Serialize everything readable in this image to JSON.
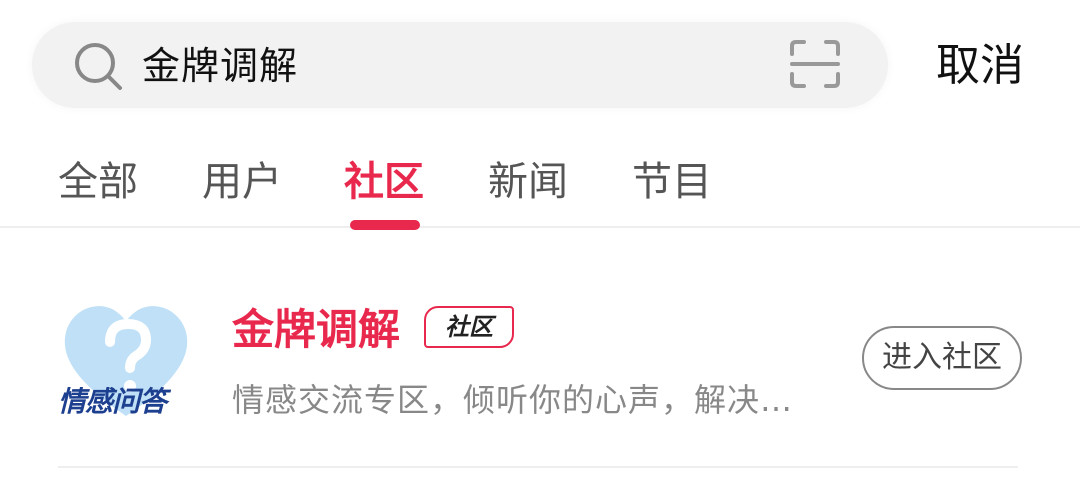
{
  "search": {
    "query": "金牌调解",
    "cancel_label": "取消"
  },
  "tabs": [
    {
      "label": "全部",
      "active": false
    },
    {
      "label": "用户",
      "active": false
    },
    {
      "label": "社区",
      "active": true
    },
    {
      "label": "新闻",
      "active": false
    },
    {
      "label": "节目",
      "active": false
    }
  ],
  "result": {
    "title": "金牌调解",
    "tag": "社区",
    "thumbnail_caption": "情感问答",
    "description": "情感交流专区，倾听你的心声，解决…",
    "enter_label": "进入社区"
  },
  "colors": {
    "accent": "#e8284c",
    "thumbnail_caption": "#1d3f8f",
    "heart_fill": "#bfe0f6"
  },
  "icons": {
    "search": "search-icon",
    "scan": "scan-icon",
    "thumbnail": "heart-question-icon"
  }
}
